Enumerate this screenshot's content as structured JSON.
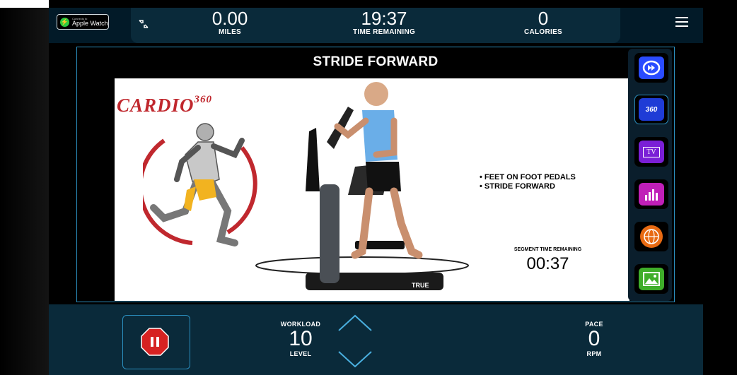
{
  "header": {
    "apple_watch": {
      "small": "Connects to",
      "big": "Apple Watch"
    },
    "miles": {
      "value": "0.00",
      "label": "MILES"
    },
    "time_remaining": {
      "value": "19:37",
      "label": "TIME REMAINING"
    },
    "calories": {
      "value": "0",
      "label": "CALORIES"
    }
  },
  "segment": {
    "title": "STRIDE FORWARD",
    "logo_text": "CARDIO",
    "logo_sup": "360",
    "bullets": [
      "FEET ON FOOT PEDALS",
      "STRIDE FORWARD"
    ],
    "segment_time_label": "SEGMENT TIME REMAINING",
    "segment_time_value": "00:37",
    "machine_brand": "TRUE"
  },
  "side_buttons": [
    {
      "name": "skip-icon",
      "color": "#2a4cff"
    },
    {
      "name": "cardio360-icon",
      "color": "#1f3cd6",
      "label": "360"
    },
    {
      "name": "tv-icon",
      "color": "#7a1fd6",
      "label": "TV"
    },
    {
      "name": "stats-icon",
      "color": "#c01fb8"
    },
    {
      "name": "www-icon",
      "color": "#e86a12"
    },
    {
      "name": "scenery-icon",
      "color": "#3fae2a"
    }
  ],
  "controls": {
    "workload": {
      "label_top": "WORKLOAD",
      "value": "10",
      "label_bottom": "LEVEL"
    },
    "pace": {
      "label_top": "PACE",
      "value": "0",
      "label_bottom": "RPM"
    }
  },
  "colors": {
    "accent": "#2b8fbf",
    "stop": "#d62222",
    "logo_red": "#c0282e"
  }
}
